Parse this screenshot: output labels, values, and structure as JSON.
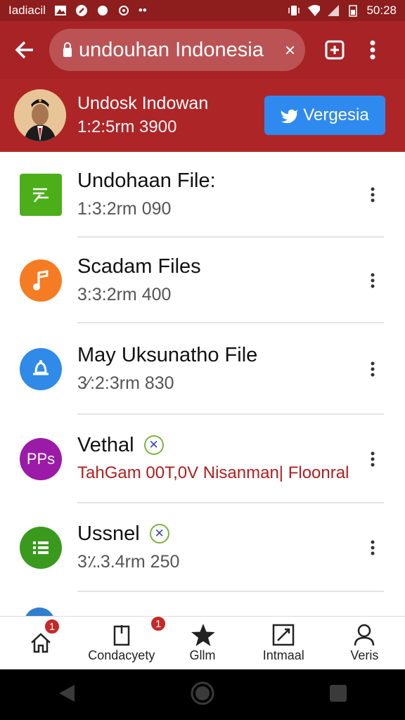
{
  "status_bar": {
    "carrier": "Iadiacil",
    "time": "50:28"
  },
  "app_bar": {
    "search_value": "undouhan Indonesia"
  },
  "profile": {
    "name": "Undosk Indowan",
    "meta": "1:2:5rm 3900",
    "follow_label": "Vergesia"
  },
  "files": [
    {
      "title": "Undohaan File:",
      "subtitle": "1:3:2rm 090",
      "icon": "document-icon",
      "color": "#4caf1a"
    },
    {
      "title": "Scadam Files",
      "subtitle": "3:3:2rm 400",
      "icon": "music-note-icon",
      "color": "#f57c22"
    },
    {
      "title": "May Uksunatho File",
      "subtitle": "3⁄:2:3rm 830",
      "icon": "bell-icon",
      "color": "#2f8ae8"
    },
    {
      "title": "Vethal",
      "subtitle": "TahGam 00T,0V Nisanman| Floonral",
      "icon": "pps-icon",
      "icon_text": "PPs",
      "color": "#9c1aa8"
    },
    {
      "title": "Ussnel",
      "subtitle": "3؉3.4rm 250",
      "icon": "list-icon",
      "color": "#3a9a1e"
    }
  ],
  "bottom_nav": [
    {
      "label": "",
      "icon": "home-icon",
      "badge": "1"
    },
    {
      "label": "Condacyety",
      "icon": "clipboard-icon",
      "badge": "1"
    },
    {
      "label": "Gllm",
      "icon": "star-icon"
    },
    {
      "label": "Intmaal",
      "icon": "edit-box-icon"
    },
    {
      "label": "Veris",
      "icon": "person-icon"
    }
  ],
  "colors": {
    "status_bar": "#8e1d1d",
    "app_bar": "#a82326",
    "profile_bg": "#ae2527",
    "follow_button": "#2f8af0",
    "warning_text": "#b01f1f",
    "badge": "#c62828"
  }
}
